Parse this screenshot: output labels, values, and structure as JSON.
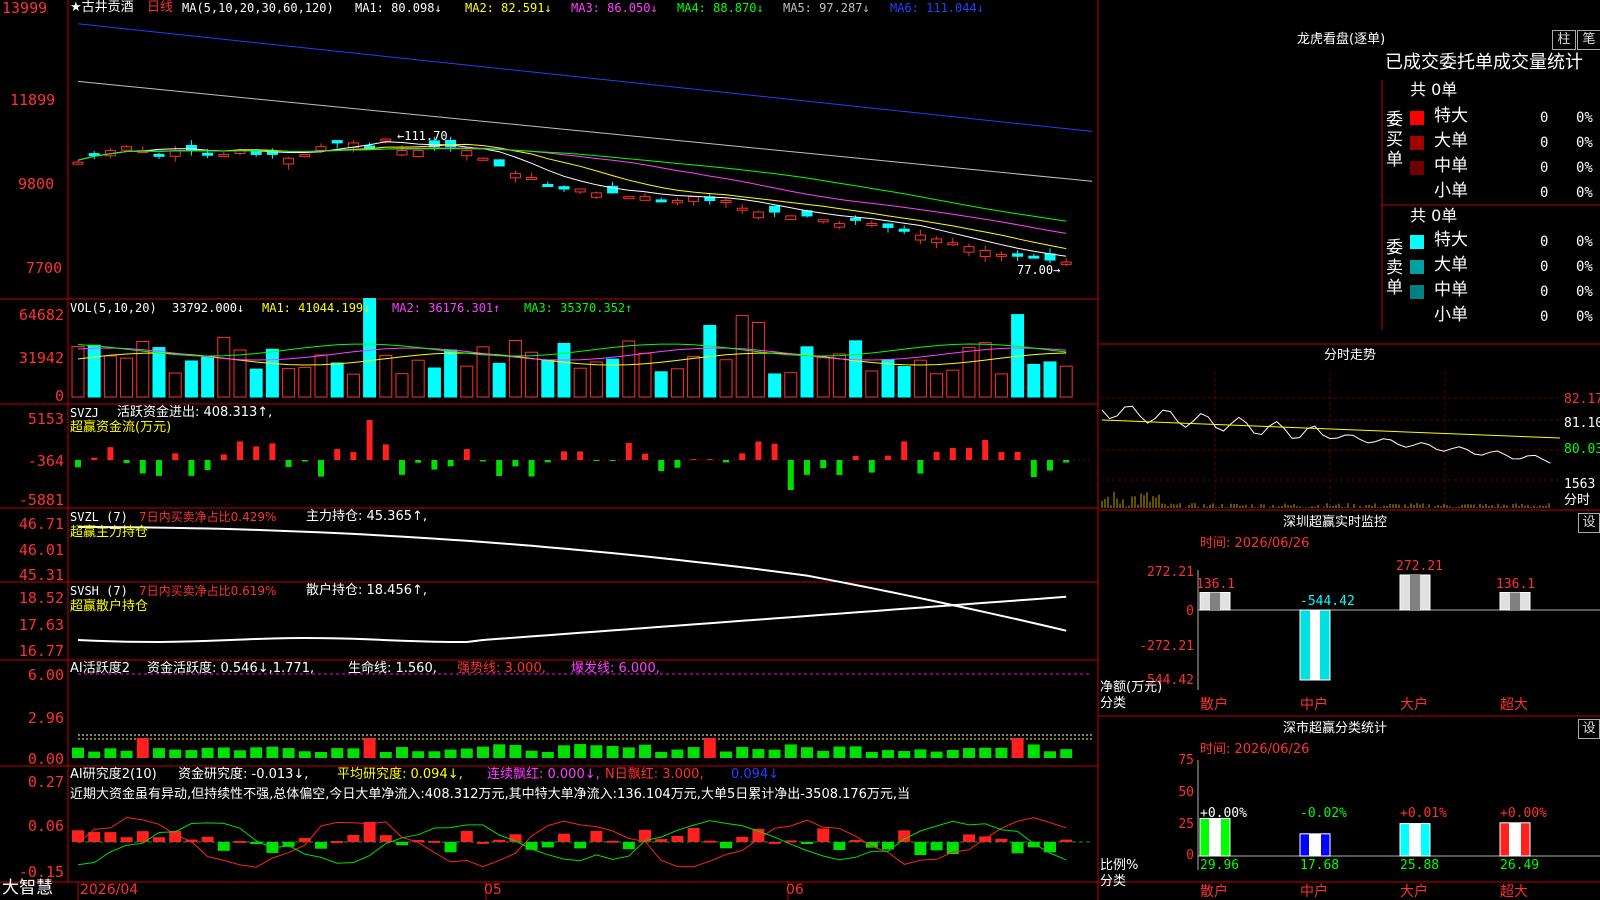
{
  "stock": {
    "name": "★古井贡酒",
    "period": "日线",
    "ma_params": "MA(5,10,20,30,60,120)",
    "ma_values": [
      {
        "label": "MA1: 80.098↓",
        "color": "#ffffff"
      },
      {
        "label": "MA2: 82.591↓",
        "color": "#ffff00"
      },
      {
        "label": "MA3: 86.050↓",
        "color": "#ff40ff"
      },
      {
        "label": "MA4: 88.870↓",
        "color": "#00ff00"
      },
      {
        "label": "MA5: 97.287↓",
        "color": "#c0c0c0"
      },
      {
        "label": "MA6: 111.044↓",
        "color": "#2040ff"
      }
    ],
    "price_axis": [
      "13999",
      "11899",
      "9800",
      "7700"
    ],
    "high_marker": "←111.70",
    "low_marker": "77.00→"
  },
  "vol": {
    "title": "VOL(5,10,20)",
    "value": "33792.000↓",
    "ma_values": [
      {
        "label": "MA1: 41044.199↓",
        "color": "#ffff00"
      },
      {
        "label": "MA2: 36176.301↑",
        "color": "#ff40ff"
      },
      {
        "label": "MA3: 35370.352↑",
        "color": "#00ff00"
      }
    ],
    "axis": [
      "64682",
      "31942",
      "0"
    ]
  },
  "svzj": {
    "title": "SVZJ",
    "line1": "活跃资金进出: 408.313↑,",
    "line2": "超赢资金流(万元)",
    "axis": [
      "5153",
      "-364",
      "-5881"
    ]
  },
  "svzl": {
    "title": "SVZL (7)",
    "desc": "7日内买卖净占比0.429%",
    "value": "主力持仓: 45.365↑,",
    "line2": "超赢主力持仓",
    "axis": [
      "46.71",
      "46.01",
      "45.31"
    ]
  },
  "svsh": {
    "title": "SVSH (7)",
    "desc": "7日内买卖净占比0.619%",
    "value": "散户持仓: 18.456↑,",
    "line2": "超赢散户持仓",
    "axis": [
      "18.52",
      "17.63",
      "16.77"
    ]
  },
  "ai_active": {
    "title": "AI活跃度2",
    "text1": "资金活跃度: 0.546↓,1.771,",
    "text2": "生命线: 1.560,",
    "text3": "强势线: 3.000,",
    "text4": "爆发线: 6.000,",
    "axis": [
      "6.00",
      "2.96",
      "0.00"
    ]
  },
  "ai_research": {
    "title": "AI研究度2(10)",
    "text1": "资金研究度: -0.013↓,",
    "text2": "平均研究度: 0.094↓,",
    "text3": "连续飘红: 0.000↓,",
    "text4": "N日飘红: 3.000,",
    "text5": "0.094↓",
    "comment": "近期大资金虽有异动,但持续性不强,总体偏空,今日大单净流入:408.312万元,其中特大单净流入:136.104万元,大单5日累计净出-3508.176万元,当",
    "axis": [
      "0.27",
      "0.06",
      "-0.15"
    ]
  },
  "bottom": {
    "app_name": "大智慧",
    "dates": [
      "2026/04",
      "05",
      "06"
    ]
  },
  "dragon": {
    "title": "龙虎看盘(逐单)",
    "btn1": "柱",
    "btn2": "笔",
    "header": "已成交委托单成交量统计",
    "buy_label": "委买单",
    "sell_label": "委卖单",
    "buy_total": "共 0单",
    "sell_total": "共 0单",
    "buy_rows": [
      {
        "name": "特大",
        "count": "0",
        "pct": "0%",
        "color": "#ff0000"
      },
      {
        "name": "大单",
        "count": "0",
        "pct": "0%",
        "color": "#a00000"
      },
      {
        "name": "中单",
        "count": "0",
        "pct": "0%",
        "color": "#700000"
      },
      {
        "name": "小单",
        "count": "0",
        "pct": "0%",
        "color": ""
      }
    ],
    "sell_rows": [
      {
        "name": "特大",
        "count": "0",
        "pct": "0%",
        "color": "#00ffff"
      },
      {
        "name": "大单",
        "count": "0",
        "pct": "0%",
        "color": "#00a0a0"
      },
      {
        "name": "中单",
        "count": "0",
        "pct": "0%",
        "color": "#008080"
      },
      {
        "name": "小单",
        "count": "0",
        "pct": "0%",
        "color": ""
      }
    ]
  },
  "intraday": {
    "title": "分时走势",
    "axis": [
      "82.17",
      "81.10",
      "80.03"
    ],
    "vol_label": "1563",
    "vol_unit": "分时"
  },
  "monitor": {
    "title": "深圳超赢实时监控",
    "btn": "设",
    "time": "时间: 2026/06/26",
    "axis": [
      "272.21",
      "0",
      "-272.21",
      "-544.42"
    ],
    "unit_label": "净额(万元)",
    "cat_label": "分类",
    "bars": [
      {
        "name": "散户",
        "value": 136.1,
        "label": "136.1"
      },
      {
        "name": "中户",
        "value": -544.42,
        "label": "-544.42"
      },
      {
        "name": "大户",
        "value": 272.21,
        "label": "272.21"
      },
      {
        "name": "超大",
        "value": 136.1,
        "label": "136.1"
      }
    ]
  },
  "classify": {
    "title": "深市超赢分类统计",
    "btn": "设",
    "time": "时间: 2026/06/26",
    "axis": [
      "75",
      "50",
      "25",
      "0"
    ],
    "unit_label": "比例%",
    "cat_label": "分类",
    "bars": [
      {
        "name": "散户",
        "value": 29.96,
        "label": "29.96",
        "change": "+0.00%",
        "color": "#00ff00"
      },
      {
        "name": "中户",
        "value": 17.68,
        "label": "17.68",
        "change": "-0.02%",
        "color": "#0000ff"
      },
      {
        "name": "大户",
        "value": 25.88,
        "label": "25.88",
        "change": "+0.01%",
        "color": "#00ffff"
      },
      {
        "name": "超大",
        "value": 26.49,
        "label": "26.49",
        "change": "+0.00%",
        "color": "#ff2020"
      }
    ]
  }
}
